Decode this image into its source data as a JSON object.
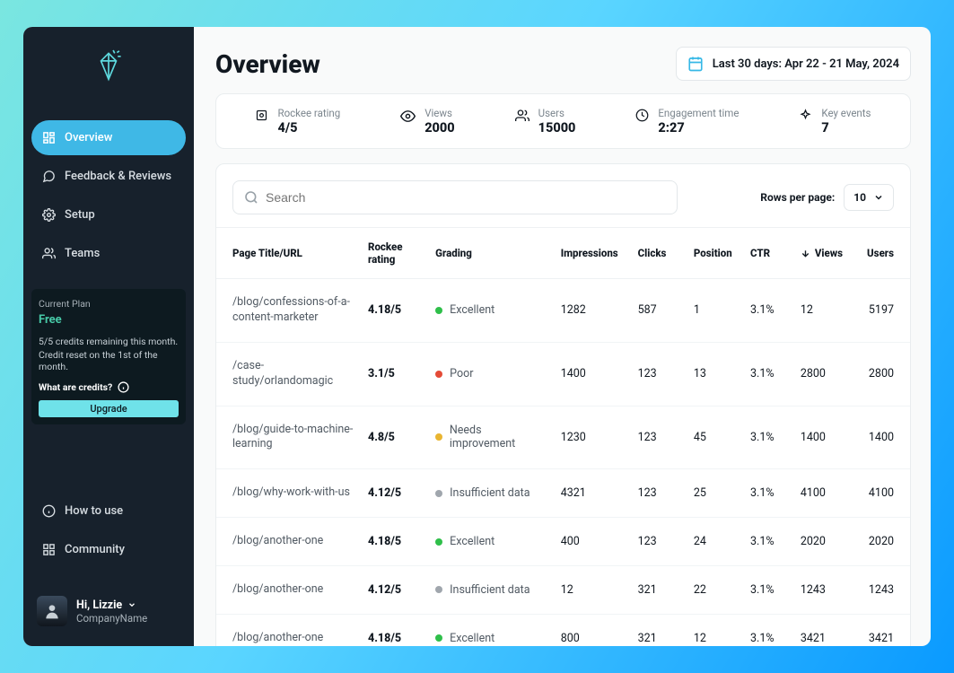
{
  "sidebar": {
    "items": [
      {
        "label": "Overview",
        "icon": "grid"
      },
      {
        "label": "Feedback & Reviews",
        "icon": "chat"
      },
      {
        "label": "Setup",
        "icon": "gear"
      },
      {
        "label": "Teams",
        "icon": "users"
      }
    ],
    "plan": {
      "title": "Current Plan",
      "name": "Free",
      "credits_line": "5/5 credits remaining this month.",
      "reset_line": "Credit reset on the 1st of the month.",
      "what_credits": "What are credits?",
      "upgrade_label": "Upgrade"
    },
    "bottom": [
      {
        "label": "How to use",
        "icon": "info"
      },
      {
        "label": "Community",
        "icon": "community"
      }
    ],
    "user": {
      "greeting": "Hi, Lizzie",
      "company": "CompanyName"
    }
  },
  "header": {
    "title": "Overview",
    "date_label": "Last 30 days: Apr 22 - 21 May, 2024"
  },
  "stats": [
    {
      "label": "Rockee rating",
      "value": "4/5",
      "icon": "badge"
    },
    {
      "label": "Views",
      "value": "2000",
      "icon": "eye"
    },
    {
      "label": "Users",
      "value": "15000",
      "icon": "users"
    },
    {
      "label": "Engagement time",
      "value": "2:27",
      "icon": "clock"
    },
    {
      "label": "Key events",
      "value": "7",
      "icon": "sparkle"
    }
  ],
  "search": {
    "placeholder": "Search"
  },
  "rows_per_page": {
    "label": "Rows per page:",
    "value": "10"
  },
  "columns": {
    "url": "Page Title/URL",
    "rating": "Rockee rating",
    "grading": "Grading",
    "impressions": "Impressions",
    "clicks": "Clicks",
    "position": "Position",
    "ctr": "CTR",
    "views": "Views",
    "users": "Users"
  },
  "grades": {
    "excellent": "Excellent",
    "poor": "Poor",
    "needs": "Needs improvement",
    "insufficient": "Insufficient data"
  },
  "rows": [
    {
      "url": "/blog/confessions-of-a-content-marketer",
      "rating": "4.18/5",
      "grade": "excellent",
      "impressions": "1282",
      "clicks": "587",
      "position": "1",
      "ctr": "3.1%",
      "views": "12",
      "users": "5197"
    },
    {
      "url": "/case-study/orlandomagic",
      "rating": "3.1/5",
      "grade": "poor",
      "impressions": "1400",
      "clicks": "123",
      "position": "13",
      "ctr": "3.1%",
      "views": "2800",
      "users": "2800"
    },
    {
      "url": "/blog/guide-to-machine-learning",
      "rating": "4.8/5",
      "grade": "needs",
      "impressions": "1230",
      "clicks": "123",
      "position": "45",
      "ctr": "3.1%",
      "views": "1400",
      "users": "1400"
    },
    {
      "url": "/blog/why-work-with-us",
      "rating": "4.12/5",
      "grade": "insufficient",
      "impressions": "4321",
      "clicks": "123",
      "position": "25",
      "ctr": "3.1%",
      "views": "4100",
      "users": "4100"
    },
    {
      "url": "/blog/another-one",
      "rating": "4.18/5",
      "grade": "excellent",
      "impressions": "400",
      "clicks": "123",
      "position": "24",
      "ctr": "3.1%",
      "views": "2020",
      "users": "2020"
    },
    {
      "url": "/blog/another-one",
      "rating": "4.12/5",
      "grade": "insufficient",
      "impressions": "12",
      "clicks": "321",
      "position": "22",
      "ctr": "3.1%",
      "views": "1243",
      "users": "1243"
    },
    {
      "url": "/blog/another-one",
      "rating": "4.18/5",
      "grade": "excellent",
      "impressions": "800",
      "clicks": "321",
      "position": "12",
      "ctr": "3.1%",
      "views": "3421",
      "users": "3421"
    }
  ]
}
